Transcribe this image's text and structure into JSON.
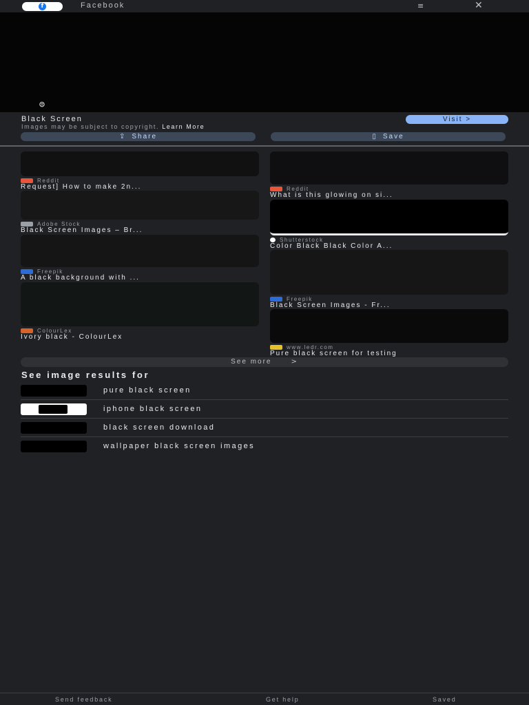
{
  "topbar": {
    "logo_letter": "f",
    "title": "Facebook",
    "menu_glyph": "≡",
    "close_glyph": "✕"
  },
  "hero": {
    "lens_glyph": "⊜"
  },
  "info": {
    "title": "Black Screen",
    "copyright": "Images may be subject to copyright.",
    "learn_more": "Learn More",
    "visit_label": "Visit  >",
    "share_label": "Share",
    "share_icon": "⇪",
    "save_label": "Save",
    "save_icon": "▯"
  },
  "results_left": [
    {
      "source": "Reddit",
      "caption": "Request] How to make 2n...",
      "fav_color": "#e8553a",
      "thumb_color": "#141414"
    },
    {
      "source": "Adobe Stock",
      "caption": "Black Screen Images – Br...",
      "fav_color": "#9aa0a6",
      "thumb_color": "#171717"
    },
    {
      "source": "Freepik",
      "caption": "A black background with ...",
      "fav_color": "#2d6bd8",
      "thumb_color": "#151515"
    },
    {
      "source": "ColourLex",
      "caption": "Ivory black - ColourLex",
      "fav_color": "#d9622b",
      "thumb_color": "#121614"
    }
  ],
  "results_right": [
    {
      "source": "Reddit",
      "caption": "What is this glowing on si...",
      "fav_color": "#e8553a",
      "thumb_color": "#0f0f12"
    },
    {
      "source": "Shutterstock",
      "caption": "Color Black Black Color A...",
      "fav_color": "#ffffff",
      "thumb_color": "#000000"
    },
    {
      "source": "Freepik",
      "caption": "Black Screen Images - Fr...",
      "fav_color": "#2d6bd8",
      "thumb_color": "#161616"
    },
    {
      "source": "www.ledr.com",
      "caption": "Pure black screen for testing",
      "fav_color": "#e6c229",
      "thumb_color": "#0a0a0a"
    }
  ],
  "see_more": {
    "label": "See more",
    "chevron": ">"
  },
  "related": {
    "heading": "See image results for",
    "items": [
      {
        "label": "pure black screen"
      },
      {
        "label": "iphone black screen"
      },
      {
        "label": "black screen download"
      },
      {
        "label": "wallpaper black screen images"
      }
    ]
  },
  "footer": {
    "send_feedback": "Send feedback",
    "get_help": "Get help",
    "saved": "Saved"
  }
}
